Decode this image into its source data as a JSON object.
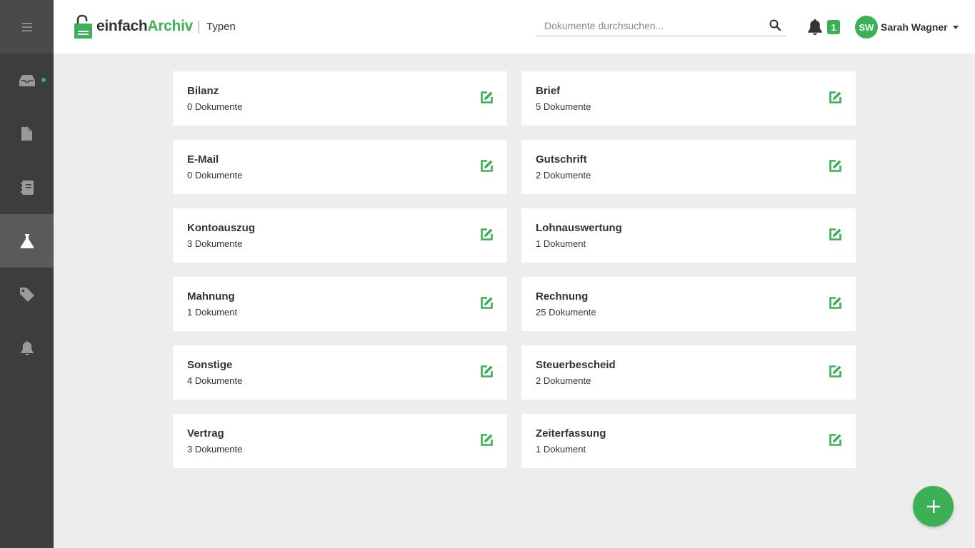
{
  "colors": {
    "accent": "#3cb054",
    "sidebar": "#3d3d3d",
    "icon_gray": "#9a9a9a"
  },
  "app": {
    "logo_part1": "einfach",
    "logo_part2": "Archiv",
    "breadcrumb": "Typen"
  },
  "sidebar": {
    "items": [
      {
        "icon": "menu-icon"
      },
      {
        "icon": "inbox-icon",
        "has_dot": true
      },
      {
        "icon": "document-icon"
      },
      {
        "icon": "notebook-icon"
      },
      {
        "icon": "flask-icon",
        "active": true
      },
      {
        "icon": "tag-icon"
      },
      {
        "icon": "bell-icon"
      }
    ]
  },
  "search": {
    "placeholder": "Dokumente durchsuchen..."
  },
  "notifications": {
    "count": "1"
  },
  "user": {
    "initials": "SW",
    "name": "Sarah Wagner"
  },
  "types": [
    {
      "name": "Bilanz",
      "count": "0 Dokumente"
    },
    {
      "name": "Brief",
      "count": "5 Dokumente"
    },
    {
      "name": "E-Mail",
      "count": "0 Dokumente"
    },
    {
      "name": "Gutschrift",
      "count": "2 Dokumente"
    },
    {
      "name": "Kontoauszug",
      "count": "3 Dokumente"
    },
    {
      "name": "Lohnauswertung",
      "count": "1 Dokument"
    },
    {
      "name": "Mahnung",
      "count": "1 Dokument"
    },
    {
      "name": "Rechnung",
      "count": "25 Dokumente"
    },
    {
      "name": "Sonstige",
      "count": "4 Dokumente"
    },
    {
      "name": "Steuerbescheid",
      "count": "2 Dokumente"
    },
    {
      "name": "Vertrag",
      "count": "3 Dokumente"
    },
    {
      "name": "Zeiterfassung",
      "count": "1 Dokument"
    }
  ],
  "fab": {
    "icon": "plus-icon"
  }
}
